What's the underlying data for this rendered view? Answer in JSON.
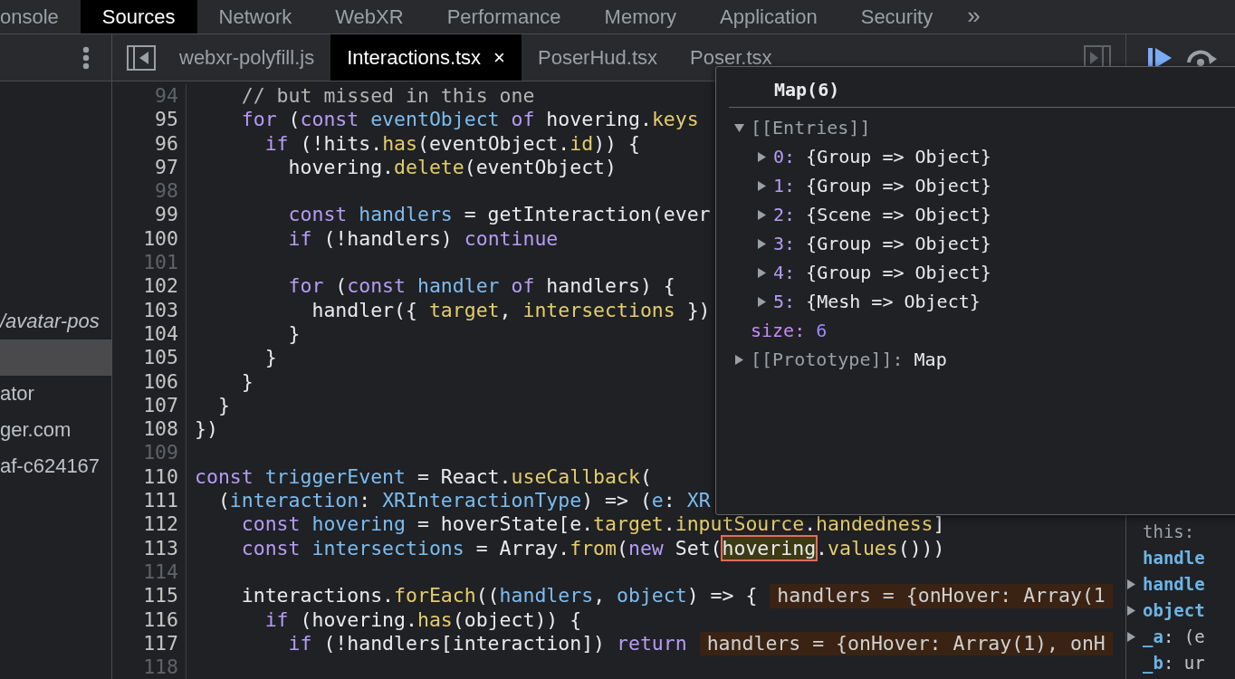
{
  "main_tabs": [
    {
      "label": "onsole",
      "selected": false
    },
    {
      "label": "Sources",
      "selected": true
    },
    {
      "label": "Network",
      "selected": false
    },
    {
      "label": "WebXR",
      "selected": false
    },
    {
      "label": "Performance",
      "selected": false
    },
    {
      "label": "Memory",
      "selected": false
    },
    {
      "label": "Application",
      "selected": false
    },
    {
      "label": "Security",
      "selected": false
    }
  ],
  "more_tabs": "»",
  "navigator": {
    "items": [
      {
        "text": "/avatar-pos",
        "kind": "path",
        "selected": false
      },
      {
        "kind": "file",
        "selected": true
      },
      {
        "text": "ator",
        "kind": "host",
        "selected": false
      },
      {
        "text": "ger.com",
        "kind": "host",
        "selected": false
      },
      {
        "text": "af-c624167",
        "kind": "host",
        "selected": false
      }
    ]
  },
  "editor_tabs": [
    {
      "label": "webxr-polyfill.js",
      "selected": false
    },
    {
      "label": "Interactions.tsx",
      "selected": true,
      "close": "×"
    },
    {
      "label": "PoserHud.tsx",
      "selected": false
    },
    {
      "label": "Poser.tsx",
      "selected": false
    }
  ],
  "code_lines": [
    {
      "number": "94",
      "muted": true,
      "tokens": [
        {
          "kind": "comment",
          "text": "    // but missed in this one"
        }
      ]
    },
    {
      "number": "95",
      "muted": false,
      "tokens": [
        {
          "kind": "keyword",
          "text": "    for"
        },
        {
          "kind": "plain",
          "text": " ("
        },
        {
          "kind": "keyword",
          "text": "const"
        },
        {
          "kind": "variable",
          "text": " eventObject"
        },
        {
          "kind": "keyword",
          "text": " of"
        },
        {
          "kind": "plain",
          "text": " hovering."
        },
        {
          "kind": "function",
          "text": "keys"
        }
      ]
    },
    {
      "number": "96",
      "muted": false,
      "tokens": [
        {
          "kind": "keyword",
          "text": "      if"
        },
        {
          "kind": "plain",
          "text": " (!hits."
        },
        {
          "kind": "function",
          "text": "has"
        },
        {
          "kind": "plain",
          "text": "(eventObject."
        },
        {
          "kind": "function",
          "text": "id"
        },
        {
          "kind": "plain",
          "text": ")) {"
        }
      ]
    },
    {
      "number": "97",
      "muted": false,
      "tokens": [
        {
          "kind": "plain",
          "text": "        hovering."
        },
        {
          "kind": "function",
          "text": "delete"
        },
        {
          "kind": "plain",
          "text": "(eventObject)"
        }
      ]
    },
    {
      "number": "98",
      "muted": true
    },
    {
      "number": "99",
      "muted": false,
      "tokens": [
        {
          "kind": "keyword",
          "text": "        const"
        },
        {
          "kind": "variable",
          "text": " handlers"
        },
        {
          "kind": "plain",
          "text": " = getInteraction(ever"
        }
      ]
    },
    {
      "number": "100",
      "muted": false,
      "tokens": [
        {
          "kind": "keyword",
          "text": "        if"
        },
        {
          "kind": "plain",
          "text": " (!handlers)"
        },
        {
          "kind": "keyword",
          "text": " continue"
        }
      ]
    },
    {
      "number": "101",
      "muted": true
    },
    {
      "number": "102",
      "muted": false,
      "tokens": [
        {
          "kind": "keyword",
          "text": "        for"
        },
        {
          "kind": "plain",
          "text": " ("
        },
        {
          "kind": "keyword",
          "text": "const"
        },
        {
          "kind": "variable",
          "text": " handler"
        },
        {
          "kind": "keyword",
          "text": " of"
        },
        {
          "kind": "plain",
          "text": " handlers) {"
        }
      ]
    },
    {
      "number": "103",
      "muted": false,
      "tokens": [
        {
          "kind": "plain",
          "text": "          handler({"
        },
        {
          "kind": "function",
          "text": " target"
        },
        {
          "kind": "plain",
          "text": ","
        },
        {
          "kind": "function",
          "text": " intersections"
        },
        {
          "kind": "plain",
          "text": " })"
        }
      ]
    },
    {
      "number": "104",
      "muted": false,
      "tokens": [
        {
          "kind": "plain",
          "text": "        }"
        }
      ]
    },
    {
      "number": "105",
      "muted": false,
      "tokens": [
        {
          "kind": "plain",
          "text": "      }"
        }
      ]
    },
    {
      "number": "106",
      "muted": false,
      "tokens": [
        {
          "kind": "plain",
          "text": "    }"
        }
      ]
    },
    {
      "number": "107",
      "muted": false,
      "tokens": [
        {
          "kind": "plain",
          "text": "  }"
        }
      ]
    },
    {
      "number": "108",
      "muted": false,
      "tokens": [
        {
          "kind": "plain",
          "text": "})"
        }
      ]
    },
    {
      "number": "109",
      "muted": true
    },
    {
      "number": "110",
      "muted": false,
      "tokens": [
        {
          "kind": "keyword",
          "text": "const"
        },
        {
          "kind": "variable",
          "text": " triggerEvent"
        },
        {
          "kind": "plain",
          "text": " = React."
        },
        {
          "kind": "function",
          "text": "useCallback"
        },
        {
          "kind": "plain",
          "text": "("
        }
      ]
    },
    {
      "number": "111",
      "muted": false,
      "tokens": [
        {
          "kind": "plain",
          "text": "  ("
        },
        {
          "kind": "variable",
          "text": "interaction"
        },
        {
          "kind": "plain",
          "text": ":"
        },
        {
          "kind": "variable",
          "text": " XRInteractionType"
        },
        {
          "kind": "plain",
          "text": ") => ("
        },
        {
          "kind": "variable",
          "text": "e"
        },
        {
          "kind": "plain",
          "text": ":"
        },
        {
          "kind": "variable",
          "text": " XR"
        }
      ]
    },
    {
      "number": "112",
      "muted": false,
      "tokens": [
        {
          "kind": "keyword",
          "text": "    const"
        },
        {
          "kind": "variable",
          "text": " hovering"
        },
        {
          "kind": "plain",
          "text": " = hoverState[e."
        },
        {
          "kind": "function",
          "text": "target"
        },
        {
          "kind": "plain",
          "text": "."
        },
        {
          "kind": "function",
          "text": "inputSource"
        },
        {
          "kind": "plain",
          "text": "."
        },
        {
          "kind": "function",
          "text": "handedness"
        },
        {
          "kind": "plain",
          "text": "]"
        }
      ]
    },
    {
      "number": "113",
      "muted": false,
      "tokens": [
        {
          "kind": "keyword",
          "text": "    const"
        },
        {
          "kind": "variable",
          "text": " intersections"
        },
        {
          "kind": "plain",
          "text": " = Array."
        },
        {
          "kind": "function",
          "text": "from"
        },
        {
          "kind": "plain",
          "text": "("
        },
        {
          "kind": "keyword",
          "text": "new"
        },
        {
          "kind": "plain",
          "text": " Set("
        },
        {
          "kind": "hover",
          "text": "hovering"
        },
        {
          "kind": "plain",
          "text": "."
        },
        {
          "kind": "function",
          "text": "values"
        },
        {
          "kind": "plain",
          "text": "()))"
        }
      ]
    },
    {
      "number": "114",
      "muted": true
    },
    {
      "number": "115",
      "muted": false,
      "tokens": [
        {
          "kind": "plain",
          "text": "    interactions."
        },
        {
          "kind": "function",
          "text": "forEach"
        },
        {
          "kind": "plain",
          "text": "(("
        },
        {
          "kind": "variable",
          "text": "handlers"
        },
        {
          "kind": "plain",
          "text": ","
        },
        {
          "kind": "variable",
          "text": " object"
        },
        {
          "kind": "plain",
          "text": ") => {"
        },
        {
          "kind": "inline",
          "text": "handlers = {onHover: Array(1"
        }
      ]
    },
    {
      "number": "116",
      "muted": false,
      "tokens": [
        {
          "kind": "keyword",
          "text": "      if"
        },
        {
          "kind": "plain",
          "text": " (hovering."
        },
        {
          "kind": "function",
          "text": "has"
        },
        {
          "kind": "plain",
          "text": "(object)) {"
        }
      ]
    },
    {
      "number": "117",
      "muted": false,
      "tokens": [
        {
          "kind": "keyword",
          "text": "        if"
        },
        {
          "kind": "plain",
          "text": " (!handlers[interaction])"
        },
        {
          "kind": "keyword",
          "text": " return"
        },
        {
          "kind": "inline",
          "text": "handlers = {onHover: Array(1), onH"
        }
      ]
    },
    {
      "number": "118",
      "muted": true
    }
  ],
  "popover": {
    "title": "Map(6)",
    "tree": [
      {
        "key": "[[Entries]]",
        "kind": "internal",
        "expanded": true,
        "children": [
          {
            "key": "0:",
            "value": "{Group => Object}",
            "kind": "index",
            "expanded": false
          },
          {
            "key": "1:",
            "value": "{Group => Object}",
            "kind": "index",
            "expanded": false
          },
          {
            "key": "2:",
            "value": "{Scene => Object}",
            "kind": "index",
            "expanded": false
          },
          {
            "key": "3:",
            "value": "{Group => Object}",
            "kind": "index",
            "expanded": false
          },
          {
            "key": "4:",
            "value": "{Group => Object}",
            "kind": "index",
            "expanded": false
          },
          {
            "key": "5:",
            "value": "{Mesh => Object}",
            "kind": "index",
            "expanded": false
          }
        ]
      },
      {
        "key": "size:",
        "value": "6",
        "kind": "property"
      },
      {
        "key": "[[Prototype]]:",
        "value": "Map",
        "kind": "internal",
        "expanded": false
      }
    ]
  },
  "scope": {
    "items": [
      {
        "key": "this:",
        "kind": "receiver"
      },
      {
        "key": "handle",
        "kind": "local"
      },
      {
        "key": "handle",
        "kind": "local",
        "expanded": false
      },
      {
        "key": "object",
        "kind": "local",
        "expanded": false
      },
      {
        "key": "_a",
        "value": ": (e",
        "kind": "local",
        "expanded": false
      },
      {
        "key": "_b",
        "value": ": ur",
        "kind": "local"
      }
    ]
  }
}
